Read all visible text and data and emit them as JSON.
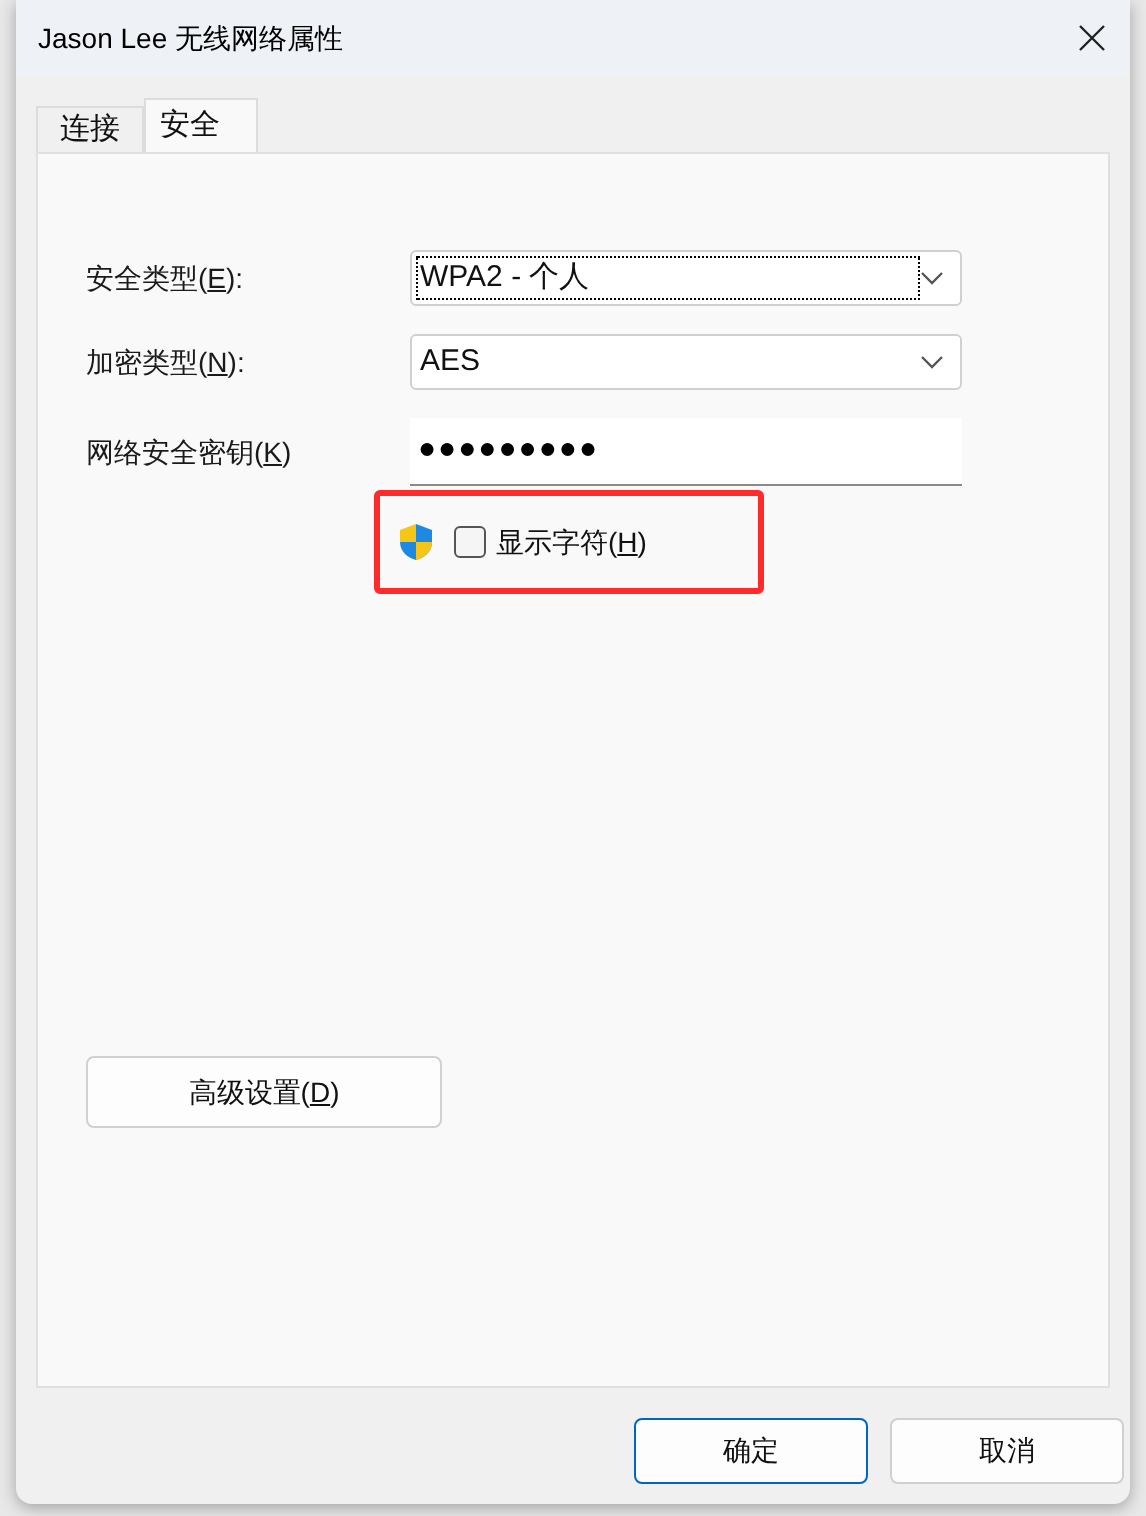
{
  "window": {
    "title": "Jason Lee 无线网络属性"
  },
  "tabs": [
    {
      "label": "连接",
      "selected": false
    },
    {
      "label": "安全",
      "selected": true
    }
  ],
  "fields": [
    {
      "kind": "dropdown",
      "label_before": "安全类型(",
      "access_key": "E",
      "label_after": "):",
      "value": "WPA2 - 个人",
      "focused": true
    },
    {
      "kind": "dropdown",
      "label_before": "加密类型(",
      "access_key": "N",
      "label_after": "):",
      "value": "AES",
      "focused": false
    },
    {
      "kind": "password",
      "label_before": "网络安全密钥(",
      "access_key": "K",
      "label_after": ")",
      "value": "●●●●●●●●●",
      "focused": false
    }
  ],
  "show_characters": {
    "label_before": "显示字符(",
    "access_key": "H",
    "label_after": ")",
    "checked": false,
    "highlighted": true
  },
  "advanced_button": {
    "label_before": "高级设置(",
    "access_key": "D",
    "label_after": ")"
  },
  "buttons": [
    {
      "label": "确定",
      "default": true
    },
    {
      "label": "取消",
      "default": false
    }
  ]
}
